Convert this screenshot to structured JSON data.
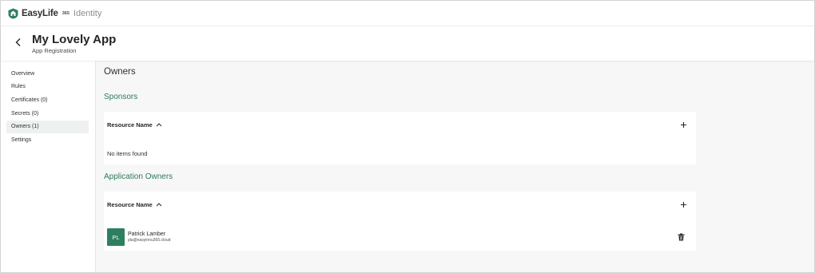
{
  "brand": {
    "name": "EasyLife",
    "sup": "365",
    "identity": "Identity",
    "accent": "#2f7a59"
  },
  "header": {
    "title": "My Lovely App",
    "subtitle": "App Registration"
  },
  "sidebar": {
    "items": [
      {
        "label": "Overview",
        "active": false
      },
      {
        "label": "Rules",
        "active": false
      },
      {
        "label": "Certificates (0)",
        "active": false
      },
      {
        "label": "Secrets (0)",
        "active": false
      },
      {
        "label": "Owners (1)",
        "active": true
      },
      {
        "label": "Settings",
        "active": false
      }
    ]
  },
  "main": {
    "section_title": "Owners",
    "sponsors": {
      "title": "Sponsors",
      "column_header": "Resource Name",
      "empty_text": "No items found"
    },
    "application_owners": {
      "title": "Application Owners",
      "column_header": "Resource Name",
      "owners": [
        {
          "initials": "PL",
          "name": "Patrick Lamber",
          "email": "pla@easyinnu365.cloud"
        }
      ]
    }
  }
}
